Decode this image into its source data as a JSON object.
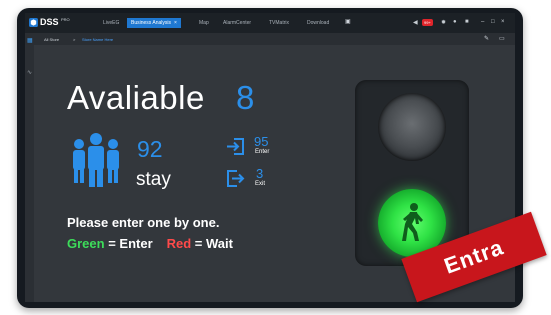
{
  "app": {
    "name": "DSS",
    "edition": "PRO",
    "tabs": [
      {
        "label": "LiveEG"
      },
      {
        "label": "Business Analysis",
        "active": true,
        "close_glyph": "×"
      },
      {
        "label": "Map"
      },
      {
        "label": "AlarmCenter"
      },
      {
        "label": "TVMatrix"
      },
      {
        "label": "Download"
      }
    ],
    "alarm_badge": "99+",
    "window_buttons": [
      "–",
      "□",
      "×"
    ]
  },
  "breadcrumb": {
    "root": "All Store",
    "separator": ">",
    "current": "Store Name Here"
  },
  "panel": {
    "title": "Avaliable",
    "available_count": "8",
    "stay_count": "92",
    "stay_label": "stay",
    "enter_count": "95",
    "enter_label": "Enter",
    "exit_count": "3",
    "exit_label": "Exit",
    "instruction": "Please enter one by one.",
    "legend": {
      "green_word": "Green",
      "green_meaning": " = Enter",
      "red_word": "Red",
      "red_meaning": " = Wait"
    }
  },
  "traffic_light": {
    "state": "green",
    "green_symbol": "walking-person-icon"
  },
  "stamp": {
    "text": "Entra"
  },
  "colors": {
    "accent": "#2b8fea",
    "green": "#3ddc5a",
    "red": "#ff4a4a",
    "stamp": "#c8161c",
    "background": "#33373c"
  }
}
